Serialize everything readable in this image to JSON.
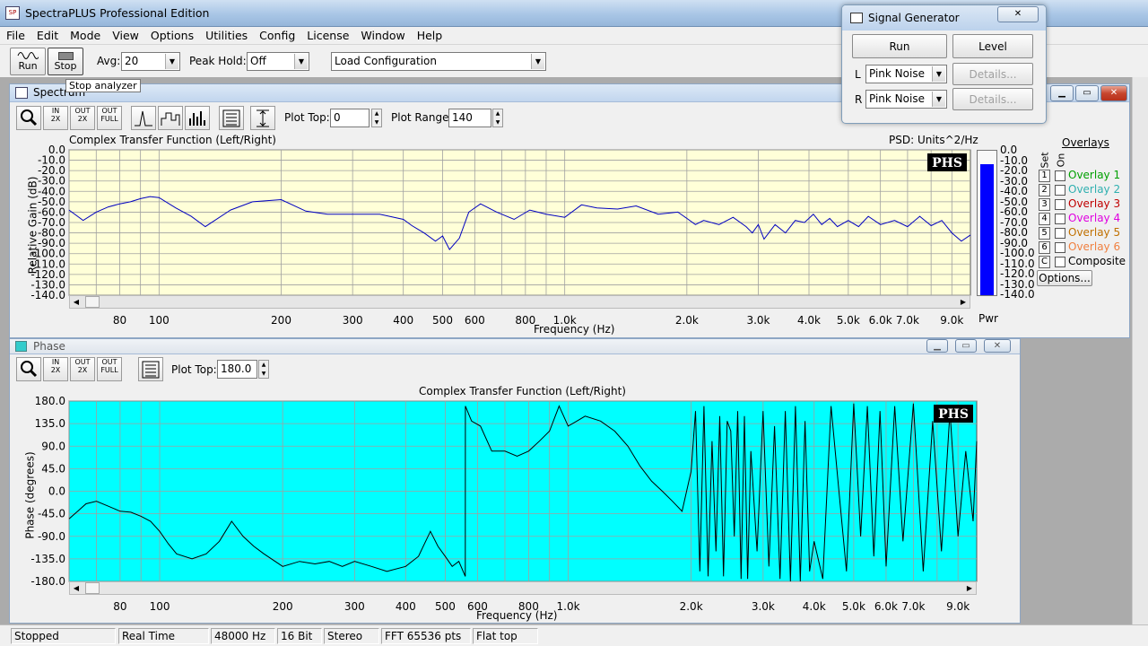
{
  "app": {
    "title": "SpectraPLUS Professional Edition"
  },
  "menu": [
    "File",
    "Edit",
    "Mode",
    "View",
    "Options",
    "Utilities",
    "Config",
    "License",
    "Window",
    "Help"
  ],
  "toolbar": {
    "run_label": "Run",
    "stop_label": "Stop",
    "stop_tooltip": "Stop analyzer",
    "avg_label": "Avg:",
    "avg_value": "20",
    "peak_label": "Peak Hold:",
    "peak_value": "Off",
    "config_value": "Load Configuration"
  },
  "spectrum": {
    "window_title": "Spectrum",
    "plot_top_label": "Plot Top:",
    "plot_top_value": "0",
    "plot_range_label": "Plot Range:",
    "plot_range_value": "140",
    "chart_title": "Complex Transfer Function (Left/Right)",
    "psd_label": "PSD: Units^2/Hz",
    "badge": "PHS",
    "y_axis_label": "Relative Gain (dB)",
    "x_axis_label": "Frequency (Hz)",
    "pwr_label": "Pwr",
    "options_label": "Options...",
    "overlays_title": "Overlays",
    "set_label": "Set",
    "on_label": "On",
    "overlays": [
      {
        "num": "1",
        "label": "Overlay 1",
        "color": "#00a000"
      },
      {
        "num": "2",
        "label": "Overlay 2",
        "color": "#30b0b0"
      },
      {
        "num": "3",
        "label": "Overlay 3",
        "color": "#c00000"
      },
      {
        "num": "4",
        "label": "Overlay 4",
        "color": "#e000e0"
      },
      {
        "num": "5",
        "label": "Overlay 5",
        "color": "#c07000"
      },
      {
        "num": "6",
        "label": "Overlay 6",
        "color": "#f08040"
      },
      {
        "num": "C",
        "label": "Composite",
        "color": "#000000"
      }
    ]
  },
  "phase": {
    "window_title": "Phase",
    "plot_top_label": "Plot Top:",
    "plot_top_value": "180.0",
    "chart_title": "Complex Transfer Function (Left/Right)",
    "badge": "PHS",
    "y_axis_label": "Phase (degrees)",
    "x_axis_label": "Frequency (Hz)"
  },
  "signal_generator": {
    "title": "Signal Generator",
    "run_label": "Run",
    "level_label": "Level",
    "left_channel": "L",
    "right_channel": "R",
    "left_signal": "Pink Noise",
    "right_signal": "Pink Noise",
    "details_label": "Details..."
  },
  "status": {
    "state": "Stopped",
    "mode": "Real Time",
    "sample_rate": "48000 Hz",
    "bits": "16 Bit",
    "channels": "Stereo",
    "fft": "FFT 65536 pts",
    "window": "Flat top"
  },
  "colors": {
    "spectrum_bg": "#ffffd8",
    "spectrum_trace": "#0000c0",
    "phase_bg": "#00ffff",
    "phase_trace": "#000000",
    "pwr_bar": "#0000ff"
  },
  "chart_data": [
    {
      "type": "line",
      "title": "Complex Transfer Function (Left/Right)",
      "xlabel": "Frequency (Hz)",
      "ylabel": "Relative Gain (dB)",
      "x_scale": "log",
      "xlim": [
        60,
        10000
      ],
      "ylim": [
        -140,
        0
      ],
      "grid": true,
      "x_tick_labels": [
        "80",
        "100",
        "200",
        "300",
        "400",
        "500",
        "600",
        "800",
        "1.0k",
        "2.0k",
        "3.0k",
        "4.0k",
        "5.0k",
        "6.0k",
        "7.0k",
        "9.0k"
      ],
      "y_tick_labels": [
        "0.0",
        "-10.0",
        "-20.0",
        "-30.0",
        "-40.0",
        "-50.0",
        "-60.0",
        "-70.0",
        "-80.0",
        "-90.0",
        "-100.0",
        "-110.0",
        "-120.0",
        "-130.0",
        "-140.0"
      ],
      "series": [
        {
          "x": [
            60,
            65,
            70,
            75,
            80,
            85,
            90,
            95,
            100,
            110,
            120,
            130,
            150,
            170,
            200,
            230,
            260,
            300,
            350,
            400,
            420,
            450,
            480,
            500,
            520,
            550,
            580,
            620,
            680,
            750,
            820,
            900,
            1000,
            1100,
            1200,
            1350,
            1500,
            1700,
            1900,
            2000,
            2100,
            2200,
            2400,
            2600,
            2800,
            2900,
            3000,
            3100,
            3300,
            3500,
            3700,
            3900,
            4100,
            4300,
            4500,
            4700,
            5000,
            5300,
            5600,
            6000,
            6500,
            7000,
            7500,
            8000,
            8500,
            9000,
            9500,
            10000
          ],
          "y": [
            -58,
            -68,
            -60,
            -55,
            -52,
            -50,
            -47,
            -45,
            -46,
            -56,
            -64,
            -74,
            -58,
            -50,
            -48,
            -59,
            -62,
            -62,
            -62,
            -67,
            -73,
            -80,
            -88,
            -83,
            -96,
            -85,
            -60,
            -52,
            -60,
            -67,
            -58,
            -62,
            -65,
            -53,
            -56,
            -57,
            -54,
            -62,
            -60,
            -66,
            -72,
            -68,
            -72,
            -65,
            -74,
            -80,
            -72,
            -86,
            -72,
            -80,
            -68,
            -70,
            -62,
            -72,
            -66,
            -74,
            -68,
            -74,
            -64,
            -72,
            -68,
            -74,
            -64,
            -73,
            -68,
            -80,
            -88,
            -82
          ]
        }
      ]
    },
    {
      "type": "line",
      "title": "Complex Transfer Function (Left/Right)",
      "xlabel": "Frequency (Hz)",
      "ylabel": "Phase (degrees)",
      "x_scale": "log",
      "xlim": [
        60,
        10000
      ],
      "ylim": [
        -180,
        180
      ],
      "grid": true,
      "x_tick_labels": [
        "80",
        "100",
        "200",
        "300",
        "400",
        "500",
        "600",
        "800",
        "1.0k",
        "2.0k",
        "3.0k",
        "4.0k",
        "5.0k",
        "6.0k",
        "7.0k",
        "9.0k"
      ],
      "y_tick_labels": [
        "180.0",
        "135.0",
        "90.0",
        "45.0",
        "0.0",
        "-45.0",
        "-90.0",
        "-135.0",
        "-180.0"
      ],
      "series": [
        {
          "x": [
            60,
            63,
            66,
            70,
            75,
            80,
            85,
            90,
            95,
            100,
            105,
            110,
            120,
            130,
            140,
            150,
            160,
            170,
            180,
            200,
            220,
            240,
            260,
            280,
            300,
            330,
            360,
            400,
            430,
            460,
            480,
            500,
            520,
            540,
            560,
            560.1,
            580,
            610,
            650,
            700,
            750,
            800,
            850,
            900,
            950,
            1000,
            1050,
            1100,
            1200,
            1300,
            1400,
            1500,
            1600,
            1700,
            1800,
            1900,
            2000,
            2050,
            2100,
            2150,
            2200,
            2250,
            2300,
            2350,
            2400,
            2450,
            2500,
            2550,
            2600,
            2650,
            2700,
            2750,
            2800,
            2900,
            3000,
            3100,
            3200,
            3300,
            3400,
            3500,
            3600,
            3700,
            3800,
            3900,
            4000,
            4200,
            4400,
            4600,
            4800,
            5000,
            5200,
            5400,
            5600,
            5800,
            6000,
            6300,
            6600,
            7000,
            7400,
            7800,
            8200,
            8600,
            9000,
            9400,
            9800,
            10000
          ],
          "y": [
            -55,
            -40,
            -25,
            -20,
            -30,
            -40,
            -42,
            -50,
            -60,
            -80,
            -105,
            -125,
            -135,
            -125,
            -100,
            -60,
            -90,
            -110,
            -125,
            -150,
            -140,
            -145,
            -140,
            -150,
            -140,
            -150,
            -160,
            -150,
            -130,
            -80,
            -110,
            -130,
            -150,
            -140,
            -170,
            170,
            140,
            130,
            80,
            80,
            70,
            80,
            100,
            120,
            170,
            130,
            140,
            150,
            140,
            120,
            90,
            50,
            20,
            0,
            -20,
            -40,
            40,
            160,
            -160,
            170,
            -170,
            100,
            -120,
            150,
            -170,
            140,
            120,
            -90,
            160,
            -175,
            150,
            -175,
            80,
            -120,
            160,
            -150,
            130,
            -175,
            160,
            -180,
            170,
            -180,
            140,
            -160,
            -100,
            -175,
            170,
            0,
            -160,
            175,
            -90,
            170,
            -130,
            160,
            -150,
            170,
            -100,
            175,
            -160,
            140,
            -120,
            160,
            -90,
            80,
            -60,
            100
          ]
        }
      ]
    }
  ]
}
